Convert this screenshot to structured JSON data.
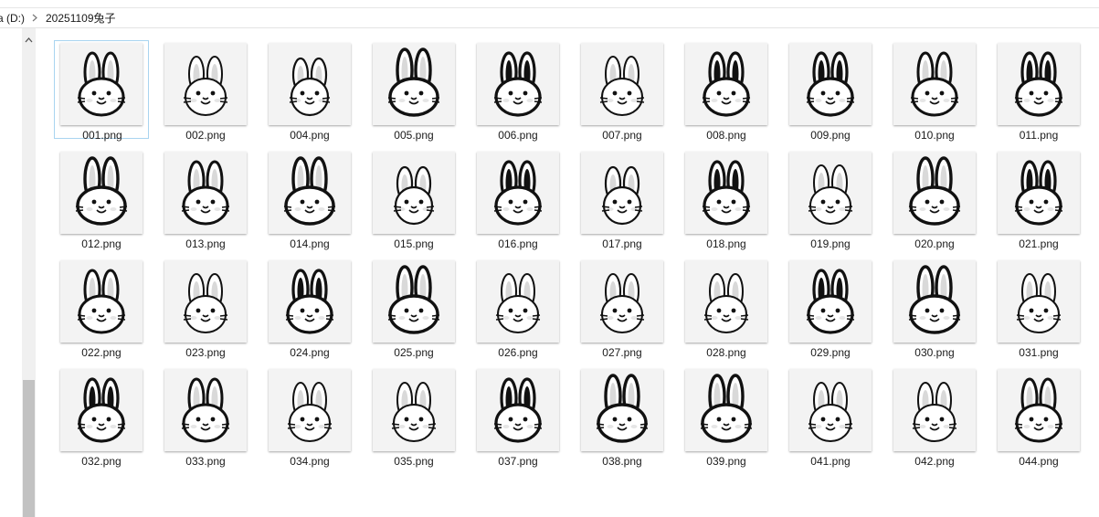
{
  "address": {
    "drive": "a (D:)",
    "folder": "20251109兔子"
  },
  "files": [
    {
      "name": "001.png",
      "selected": true,
      "variant": 0
    },
    {
      "name": "002.png",
      "variant": 1
    },
    {
      "name": "004.png",
      "variant": 2
    },
    {
      "name": "005.png",
      "variant": 3
    },
    {
      "name": "006.png",
      "variant": 4
    },
    {
      "name": "007.png",
      "variant": 1
    },
    {
      "name": "008.png",
      "variant": 4
    },
    {
      "name": "009.png",
      "variant": 4
    },
    {
      "name": "010.png",
      "variant": 0
    },
    {
      "name": "011.png",
      "variant": 4
    },
    {
      "name": "012.png",
      "variant": 3
    },
    {
      "name": "013.png",
      "variant": 0
    },
    {
      "name": "014.png",
      "variant": 3
    },
    {
      "name": "015.png",
      "variant": 2
    },
    {
      "name": "016.png",
      "variant": 4
    },
    {
      "name": "017.png",
      "variant": 2
    },
    {
      "name": "018.png",
      "variant": 4
    },
    {
      "name": "019.png",
      "variant": 1
    },
    {
      "name": "020.png",
      "variant": 3
    },
    {
      "name": "021.png",
      "variant": 4
    },
    {
      "name": "022.png",
      "variant": 0
    },
    {
      "name": "023.png",
      "variant": 1
    },
    {
      "name": "024.png",
      "variant": 4
    },
    {
      "name": "025.png",
      "variant": 3
    },
    {
      "name": "026.png",
      "variant": 1
    },
    {
      "name": "027.png",
      "variant": 1
    },
    {
      "name": "028.png",
      "variant": 1
    },
    {
      "name": "029.png",
      "variant": 4
    },
    {
      "name": "030.png",
      "variant": 3
    },
    {
      "name": "031.png",
      "variant": 1
    },
    {
      "name": "032.png",
      "variant": 4
    },
    {
      "name": "033.png",
      "variant": 0
    },
    {
      "name": "034.png",
      "variant": 1
    },
    {
      "name": "035.png",
      "variant": 1
    },
    {
      "name": "037.png",
      "variant": 4
    },
    {
      "name": "038.png",
      "variant": 3
    },
    {
      "name": "039.png",
      "variant": 3
    },
    {
      "name": "041.png",
      "variant": 1
    },
    {
      "name": "042.png",
      "variant": 1
    },
    {
      "name": "044.png",
      "variant": 0
    }
  ],
  "colors": {
    "selection_border": "#a9d4f0",
    "scrollbar_track": "#f0f0f0",
    "scrollbar_thumb": "#c2c2c2",
    "thumb_bg": "#f3f3f3"
  },
  "icons": {
    "breadcrumb_separator": "chevron-right-icon",
    "scroll_up": "chevron-up-icon",
    "thumbnail": "rabbit-face-icon"
  }
}
